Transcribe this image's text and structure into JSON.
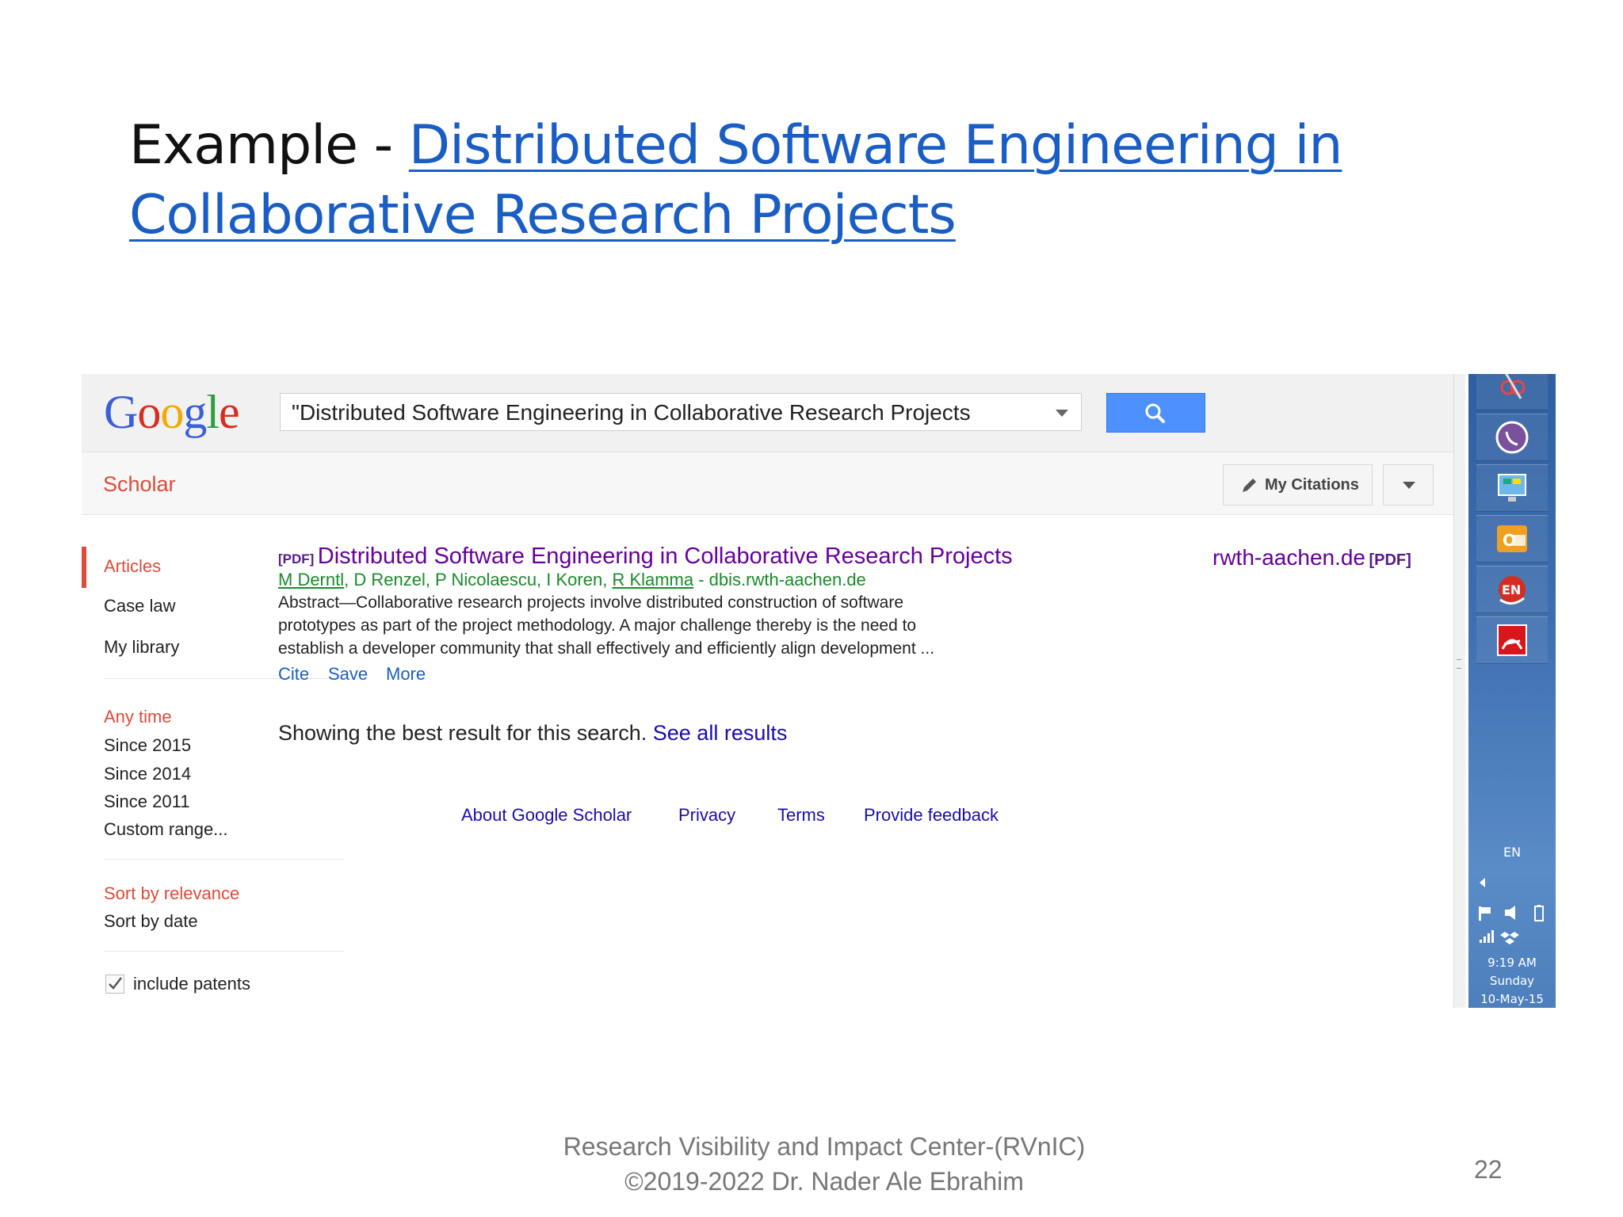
{
  "slide": {
    "title_prefix": "Example - ",
    "title_link_line1": "Distributed Software Engineering in",
    "title_link_line2": "Collaborative Research Projects",
    "footer_line1": "Research Visibility and Impact Center-(RVnIC)",
    "footer_line2": "©2019-2022 Dr. Nader Ale Ebrahim",
    "page_number": "22"
  },
  "scholar": {
    "logo_letters": [
      "G",
      "o",
      "o",
      "g",
      "l",
      "e"
    ],
    "logo_colors": [
      "#3b5fd6",
      "#d62d20",
      "#f2a900",
      "#3b5fd6",
      "#2e9e3e",
      "#d62d20"
    ],
    "search_value": "\"Distributed Software Engineering in Collaborative Research Projects",
    "section_label": "Scholar",
    "my_citations": "My Citations",
    "sidebar": {
      "articles": "Articles",
      "case_law": "Case law",
      "my_library": "My library",
      "any_time": "Any time",
      "since_2015": "Since 2015",
      "since_2014": "Since 2014",
      "since_2011": "Since 2011",
      "custom_range": "Custom range...",
      "sort_relevance": "Sort by relevance",
      "sort_date": "Sort by date",
      "include_patents": "include patents"
    },
    "result": {
      "pdf_tag": "[PDF]",
      "title": "Distributed Software Engineering in Collaborative Research Projects",
      "author1": "M Derntl",
      "authors_middle": ", D Renzel, P Nicolaescu, I Koren, ",
      "author2": "R Klamma",
      "source": " - dbis.rwth-aachen.de",
      "snippet1": "Abstract—Collaborative research projects involve distributed construction of software",
      "snippet2": "prototypes as part of the project methodology. A major challenge thereby is the need to",
      "snippet3": "establish a developer community that shall effectively and efficiently align development ...",
      "cite": "Cite",
      "save": "Save",
      "more": "More",
      "side_domain": "rwth-aachen.de",
      "side_pdf": "[PDF]"
    },
    "best_result_text": "Showing the best result for this search.",
    "see_all": "See all results",
    "footer_links": [
      "About Google Scholar",
      "Privacy",
      "Terms",
      "Provide feedback"
    ]
  },
  "taskbar": {
    "lang": "EN",
    "time": "9:19 AM",
    "day": "Sunday",
    "date": "10-May-15"
  }
}
